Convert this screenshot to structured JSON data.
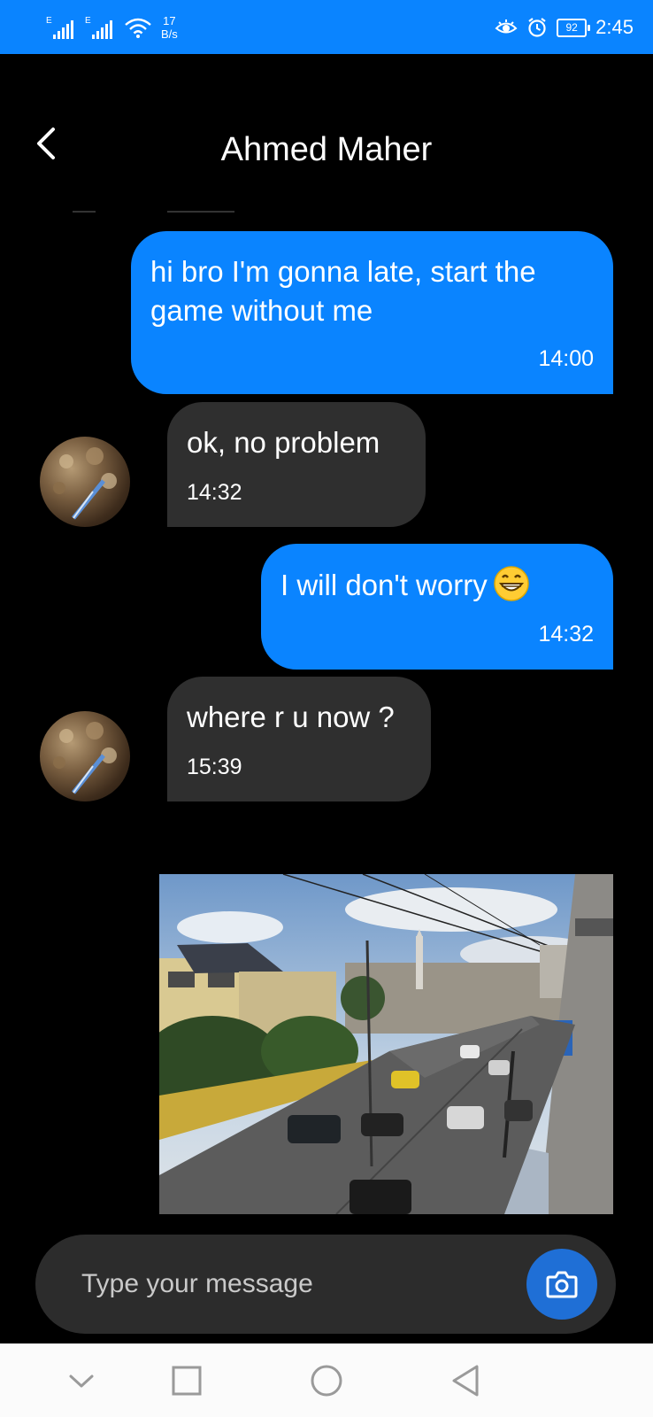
{
  "status_bar": {
    "network_label_1": "E",
    "network_label_2": "E",
    "speed_value": "17",
    "speed_unit": "B/s",
    "battery": "92",
    "time": "2:45",
    "icons": [
      "signal-icon",
      "signal-icon",
      "wifi-icon",
      "eye-comfort-icon",
      "alarm-icon",
      "battery-icon"
    ]
  },
  "header": {
    "back_icon": "chevron-left-icon",
    "title": "Ahmed Maher"
  },
  "messages": [
    {
      "direction": "outgoing",
      "text": "hi bro I'm gonna late, start the game without me",
      "time": "14:00"
    },
    {
      "direction": "incoming",
      "text": "ok, no problem",
      "time": "14:32"
    },
    {
      "direction": "outgoing",
      "text": "I will don't worry",
      "emoji": "grinning-face",
      "time": "14:32"
    },
    {
      "direction": "incoming",
      "text": "where r u now ?",
      "time": "15:39"
    },
    {
      "direction": "outgoing",
      "type": "image",
      "image": "street-photo"
    }
  ],
  "composer": {
    "placeholder": "Type your message",
    "camera_icon": "camera-icon"
  },
  "nav_bar": {
    "icons": [
      "chevron-down-icon",
      "square-icon",
      "circle-icon",
      "triangle-back-icon"
    ]
  },
  "colors": {
    "accent": "#0a84ff",
    "incoming_bubble": "#2f2f2f",
    "background": "#000000",
    "composer": "#2c2c2c"
  }
}
